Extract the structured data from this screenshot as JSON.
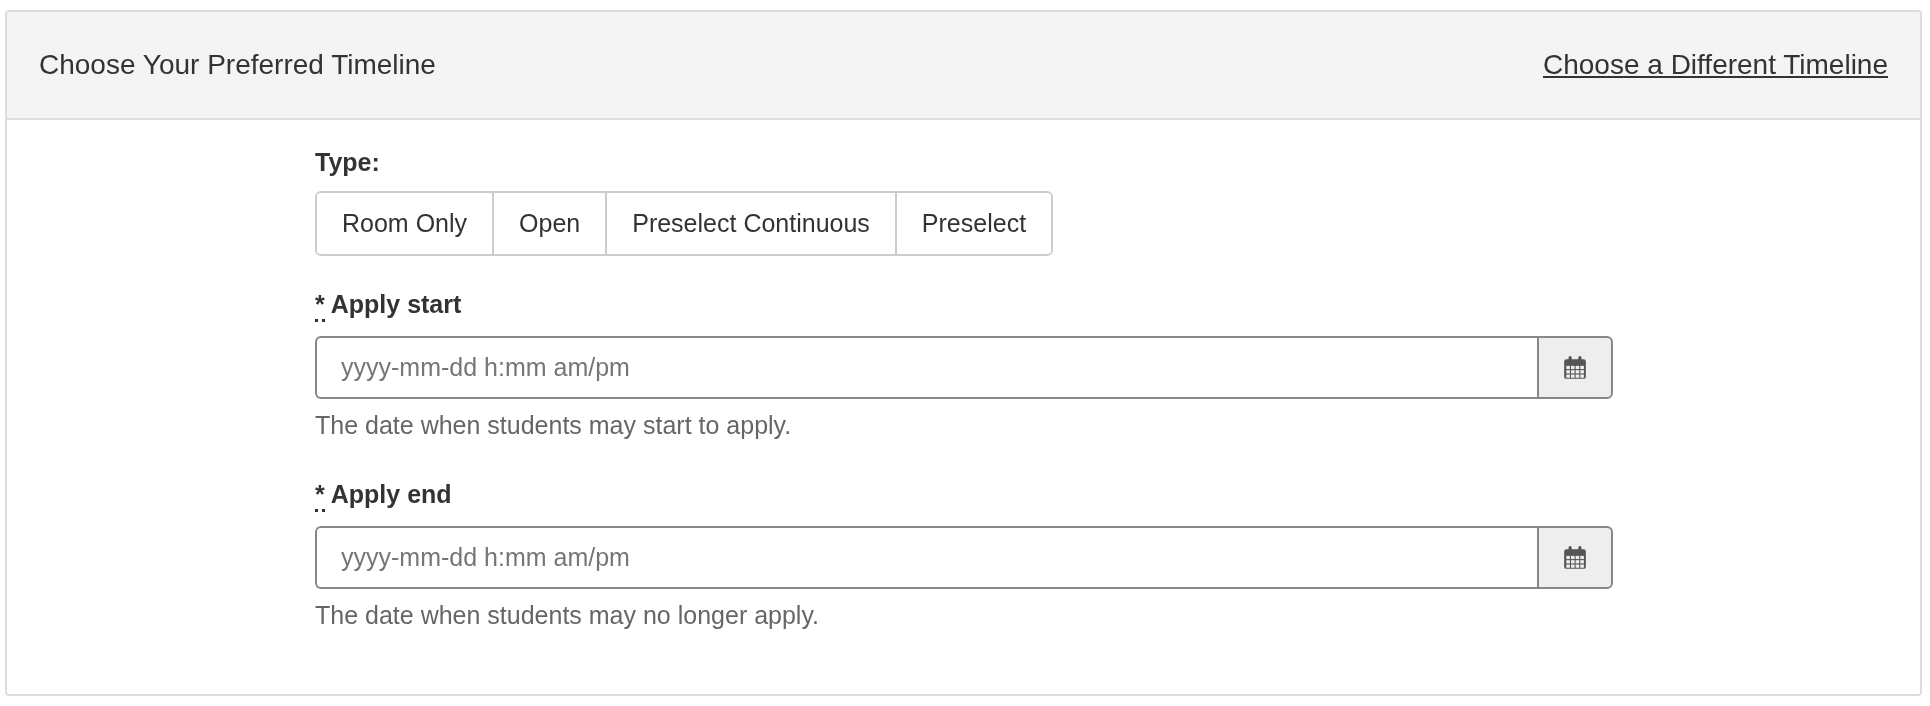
{
  "header": {
    "title": "Choose Your Preferred Timeline",
    "link": "Choose a Different Timeline"
  },
  "type_field": {
    "label": "Type:",
    "options": [
      {
        "label": "Room Only",
        "selected": false
      },
      {
        "label": "Open",
        "selected": false
      },
      {
        "label": "Preselect Continuous",
        "selected": false
      },
      {
        "label": "Preselect",
        "selected": false
      }
    ]
  },
  "fields": [
    {
      "required_mark": "*",
      "label": "Apply start",
      "placeholder": "yyyy-mm-dd h:mm am/pm",
      "help": "The date when students may start to apply."
    },
    {
      "required_mark": "*",
      "label": "Apply end",
      "placeholder": "yyyy-mm-dd h:mm am/pm",
      "help": "The date when students may no longer apply."
    }
  ]
}
